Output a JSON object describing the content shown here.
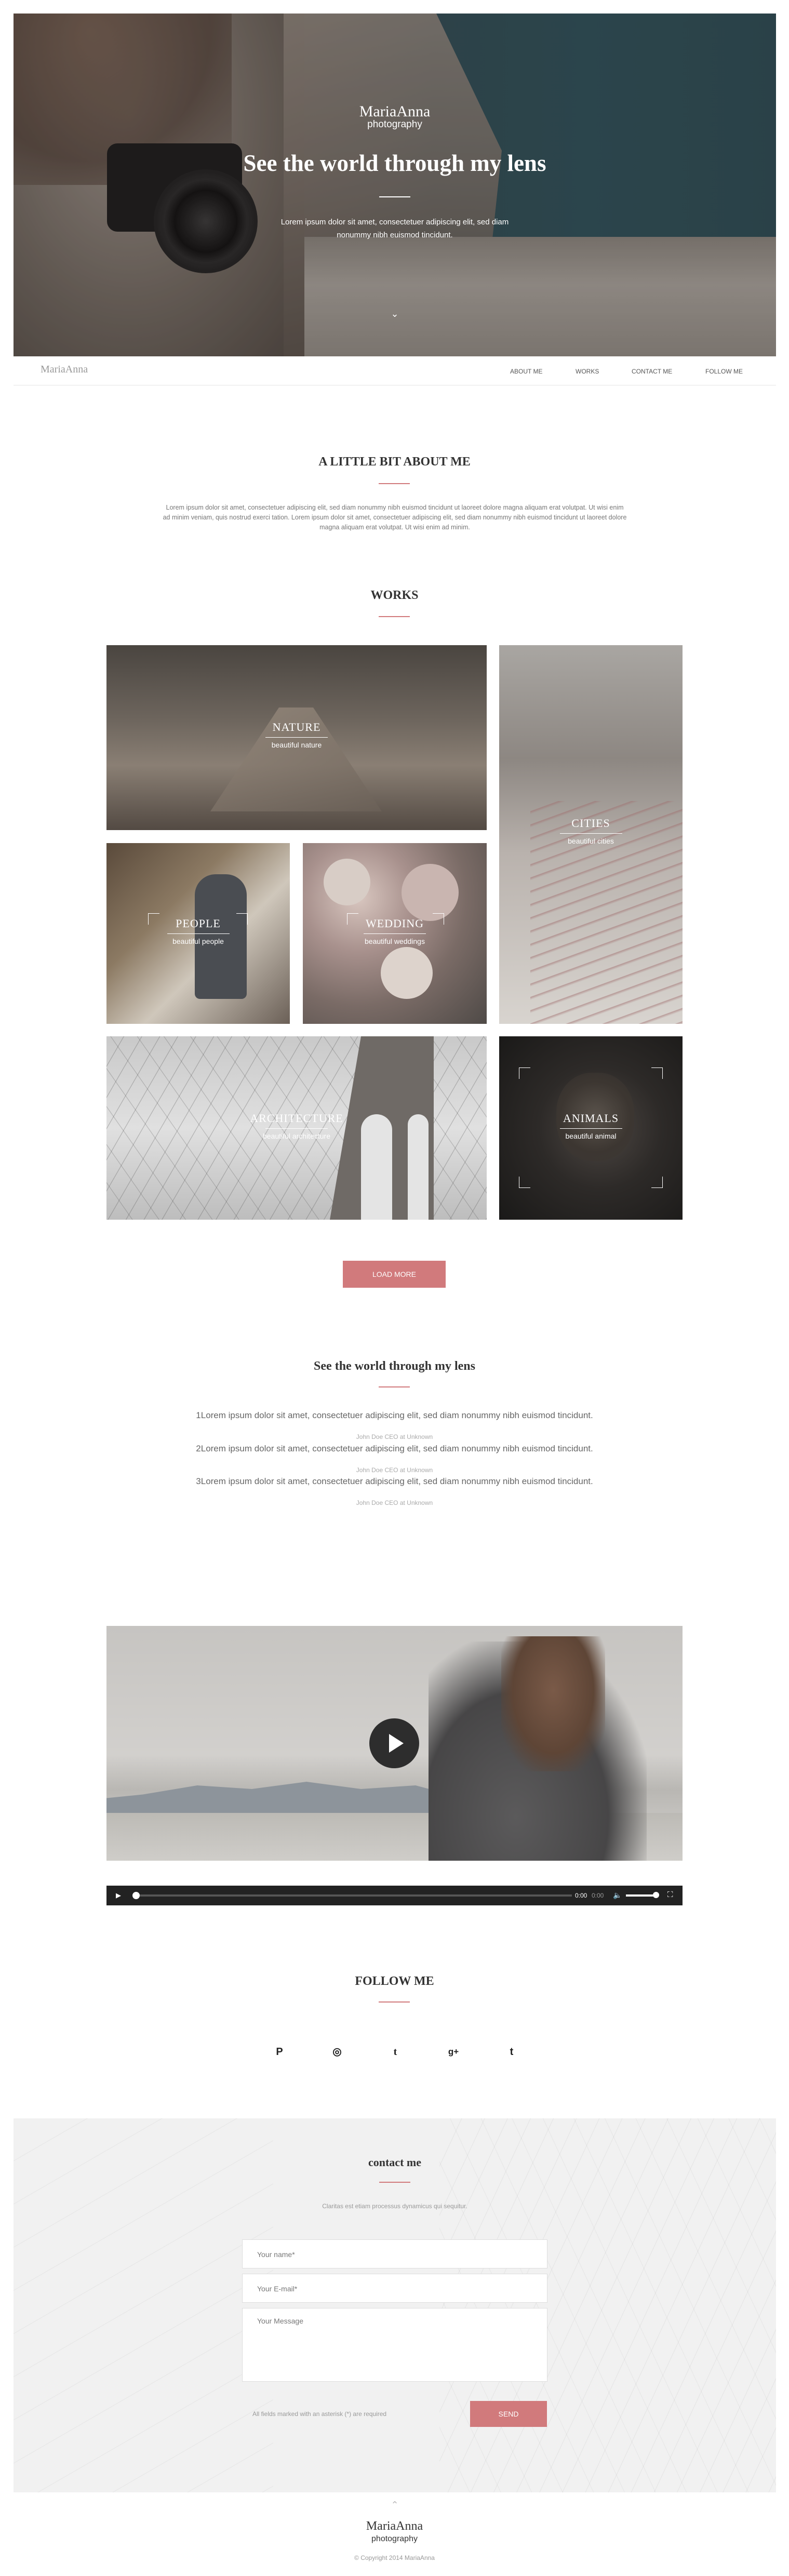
{
  "colors": {
    "accent": "#d17a7c",
    "text_dark": "#333333",
    "text_muted": "#777777"
  },
  "hero": {
    "brand_name": "MariaAnna",
    "brand_sub": "photography",
    "title": "See the world through my lens",
    "text": "Lorem ipsum dolor sit amet, consectetuer adipiscing elit, sed diam nonummy nibh euismod tincidunt.",
    "scroll_icon": "chevron-down-icon"
  },
  "nav": {
    "logo": "MariaAnna",
    "items": [
      "ABOUT ME",
      "WORKS",
      "CONTACT ME",
      "FOLLOW ME"
    ]
  },
  "about": {
    "title": "A LITTLE BIT ABOUT ME",
    "text": "Lorem ipsum dolor sit amet, consectetuer adipiscing elit, sed diam nonummy nibh euismod tincidunt ut laoreet dolore magna aliquam erat volutpat. Ut wisi enim ad minim veniam, quis nostrud exerci tation. Lorem ipsum dolor sit amet, consectetuer adipiscing elit, sed diam nonummy nibh euismod tincidunt ut laoreet dolore magna aliquam erat volutpat. Ut wisi enim ad minim."
  },
  "works": {
    "title": "WORKS",
    "tiles": [
      {
        "title": "NATURE",
        "sub": "beautiful nature"
      },
      {
        "title": "CITIES",
        "sub": "beautiful cities"
      },
      {
        "title": "PEOPLE",
        "sub": "beautiful people"
      },
      {
        "title": "WEDDING",
        "sub": "beautiful weddings"
      },
      {
        "title": "ARCHITECTURE",
        "sub": "beautiful architecture"
      },
      {
        "title": "ANIMALS",
        "sub": "beautiful animal"
      }
    ],
    "load_more": "LOAD MORE"
  },
  "testimonials": {
    "title": "See the world through my lens",
    "items": [
      {
        "quote": "1Lorem ipsum dolor sit amet, consectetuer adipiscing elit, sed diam nonummy nibh euismod tincidunt.",
        "author": "John Doe CEO at Unknown"
      },
      {
        "quote": "2Lorem ipsum dolor sit amet, consectetuer adipiscing elit, sed diam nonummy nibh euismod tincidunt.",
        "author": "John Doe CEO at Unknown"
      },
      {
        "quote": "3Lorem ipsum dolor sit amet, consectetuer adipiscing elit, sed diam nonummy nibh euismod tincidunt.",
        "author": "John Doe CEO at Unknown"
      }
    ]
  },
  "video": {
    "time": "0:00",
    "duration": "0:00",
    "icons": [
      "play-icon",
      "volume-icon",
      "fullscreen-icon"
    ]
  },
  "follow": {
    "title": "FOLLOW ME",
    "icons": [
      "pinterest-icon",
      "instagram-icon",
      "twitter-icon",
      "google-plus-icon",
      "tumblr-icon"
    ],
    "glyphs": [
      "P",
      "◎",
      "t",
      "g+",
      "t"
    ]
  },
  "contact": {
    "title": "contact me",
    "subtitle": "Claritas est etiam processus dynamicus qui sequitur.",
    "name_placeholder": "Your name*",
    "email_placeholder": "Your E-mail*",
    "message_placeholder": "Your Message",
    "required_note": "All fields marked with an asterisk (*) are required",
    "send": "SEND"
  },
  "footer": {
    "brand_name": "MariaAnna",
    "brand_sub": "photography",
    "copyright": "© Copyright 2014 MariaAnna"
  }
}
